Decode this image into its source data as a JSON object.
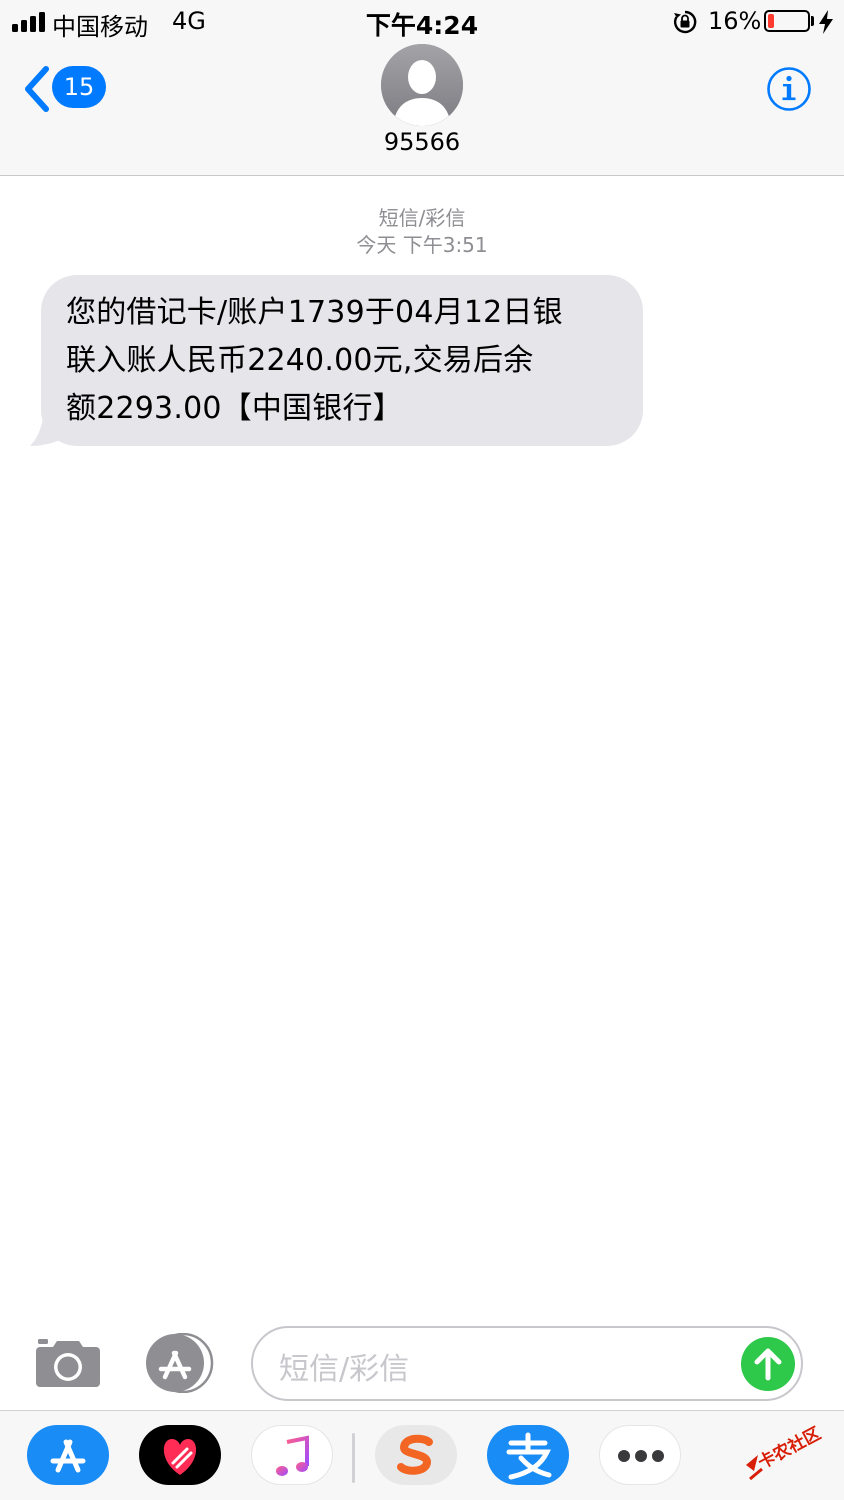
{
  "status_bar": {
    "carrier": "中国移动",
    "network": "4G",
    "time": "下午4:24",
    "battery_percent": "16%",
    "battery_level": 0.16,
    "battery_color": "#ff3b30",
    "charging": true
  },
  "header": {
    "back_count": "15",
    "contact_name": "95566",
    "accent_color": "#007aff"
  },
  "conversation": {
    "service_label": "短信/彩信",
    "timestamp": "今天 下午3:51",
    "messages": [
      {
        "direction": "incoming",
        "lines": [
          "您的借记卡/账户1739于04月12日银",
          "联入账人民币2240.00元,交易后余",
          "额2293.00【中国银行】"
        ]
      }
    ]
  },
  "compose": {
    "placeholder": "短信/彩信",
    "send_color": "#2ec84a"
  },
  "app_drawer": {
    "apps": [
      "app-store-icon",
      "heart-digital-touch-icon",
      "music-icon",
      "sogou-input-icon",
      "alipay-icon",
      "more-apps-icon"
    ],
    "watermark": "卡农社区"
  }
}
